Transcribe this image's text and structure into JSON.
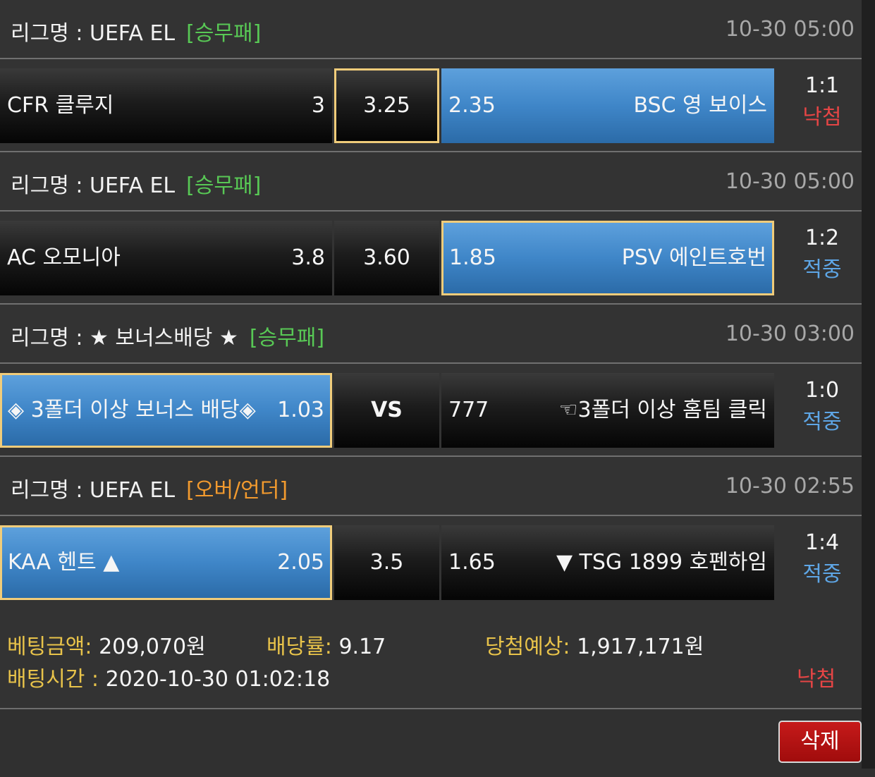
{
  "colors": {
    "win": "#e64545",
    "loss": "#5ea6e6",
    "type_1x2": "#58c855",
    "type_ou": "#f29a2e",
    "label_gold": "#e8c34a"
  },
  "matches": [
    {
      "league_label": "리그명 : UEFA EL",
      "bet_type": "[승무패]",
      "bet_type_kind": "1x2",
      "time": "10-30 05:00",
      "home": {
        "name": "CFR 클루지",
        "odds": "3"
      },
      "draw": "3.25",
      "away": {
        "name": "BSC 영 보이스",
        "odds": "2.35"
      },
      "score": "1:1",
      "status": "낙첨",
      "status_kind": "win"
    },
    {
      "league_label": "리그명 : UEFA EL",
      "bet_type": "[승무패]",
      "bet_type_kind": "1x2",
      "time": "10-30 05:00",
      "home": {
        "name": "AC 오모니아",
        "odds": "3.8"
      },
      "draw": "3.60",
      "away": {
        "name": "PSV 에인트호번",
        "odds": "1.85"
      },
      "score": "1:2",
      "status": "적중",
      "status_kind": "loss"
    },
    {
      "league_label": "리그명 : ★ 보너스배당 ★",
      "bet_type": "[승무패]",
      "bet_type_kind": "1x2",
      "time": "10-30 03:00",
      "home": {
        "name": "◈ 3폴더 이상 보너스 배당◈",
        "odds": "1.03"
      },
      "draw": "VS",
      "away": {
        "name": "☜3폴더 이상 홈팀 클릭",
        "odds": "777"
      },
      "score": "1:0",
      "status": "적중",
      "status_kind": "loss"
    },
    {
      "league_label": "리그명 : UEFA EL",
      "bet_type": "[오버/언더]",
      "bet_type_kind": "ou",
      "time": "10-30 02:55",
      "home": {
        "name": "KAA 헨트 ▲",
        "odds": "2.05"
      },
      "draw": "3.5",
      "away": {
        "name": "▼ TSG 1899 호펜하임",
        "odds": "1.65"
      },
      "score": "1:4",
      "status": "적중",
      "status_kind": "loss"
    }
  ],
  "summary": {
    "bet_amount_label": "베팅금액:",
    "bet_amount": "209,070원",
    "odds_label": "배당률:",
    "odds": "9.17",
    "expected_label": "당첨예상:",
    "expected": "1,917,171원",
    "time_label": "배팅시간 :",
    "time": "2020-10-30 01:02:18",
    "result": "낙첨"
  },
  "buttons": {
    "delete": "삭제"
  }
}
